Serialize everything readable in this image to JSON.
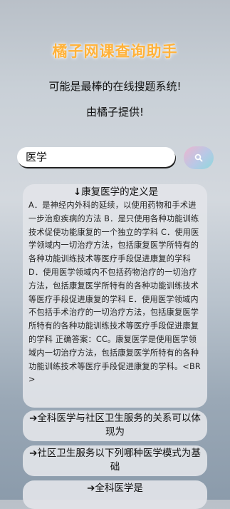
{
  "header": {
    "title": "橘子网课查询助手",
    "tagline": "可能是最棒的在线搜题系统!",
    "provider": "由橘子提供!"
  },
  "search": {
    "query": "医学",
    "button_icon": "search-icon"
  },
  "results": [
    {
      "arrow": "↓",
      "title": "康复医学的定义是",
      "body": "A．是神经内外科的延续，以使用药物和手术进一步治愈疾病的方法 B．是只使用各种功能训练技术促使功能康复的一个独立的学科 C．使用医学领域内一切治疗方法，包括康复医学所特有的各种功能训练技术等医疗手段促进康复的学科 D．使用医学领域内不包括药物治疗的一切治疗方法，包括康复医学所特有的各种功能训练技术等医疗手段促进康复的学科 E．使用医学领域内不包括手术治疗的一切治疗方法，包括康复医学所特有的各种功能训练技术等医疗手段促进康复的学科 正确答案：CC。康复医学是使用医学领域内一切治疗方法，包括康复医学所特有的各种功能训练技术等医疗手段促进康复的学科。<BR>"
    },
    {
      "arrow": "➔",
      "title": "全科医学与社区卫生服务的关系可以体现为"
    },
    {
      "arrow": "➔",
      "title": "社区卫生服务以下列哪种医学模式为基础"
    },
    {
      "arrow": "➔",
      "title": "全科医学是"
    }
  ],
  "colors": {
    "title_orange": "#ffb23a",
    "card_bg": "#e2e4e8"
  }
}
